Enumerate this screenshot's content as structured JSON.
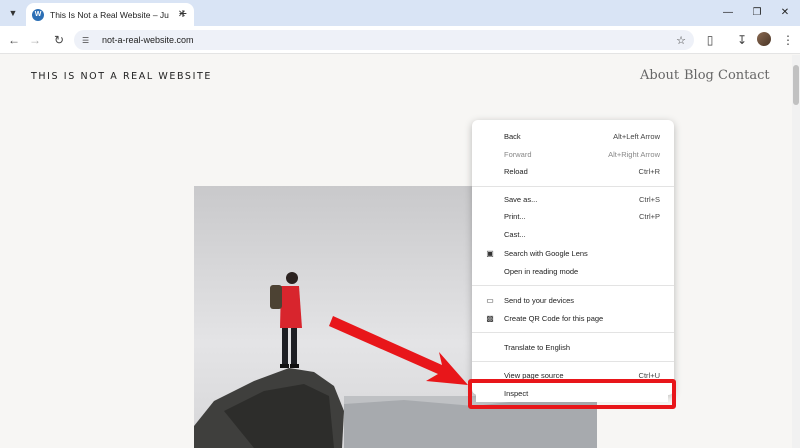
{
  "browser": {
    "tab_title": "This Is Not a Real Website – Ju",
    "favicon_letter": "W",
    "url": "not-a-real-website.com"
  },
  "site": {
    "title": "THIS IS NOT A REAL WEBSITE",
    "nav": [
      "About",
      "Blog",
      "Contact"
    ]
  },
  "context_menu": {
    "items": [
      {
        "label": "Back",
        "shortcut": "Alt+Left Arrow",
        "disabled": false
      },
      {
        "label": "Forward",
        "shortcut": "Alt+Right Arrow",
        "disabled": true
      },
      {
        "label": "Reload",
        "shortcut": "Ctrl+R",
        "disabled": false
      },
      {
        "label": "Save as...",
        "shortcut": "Ctrl+S",
        "disabled": false
      },
      {
        "label": "Print...",
        "shortcut": "Ctrl+P",
        "disabled": false
      },
      {
        "label": "Cast...",
        "shortcut": "",
        "disabled": false
      },
      {
        "label": "Search with Google Lens",
        "shortcut": "",
        "icon": "lens-icon",
        "disabled": false
      },
      {
        "label": "Open in reading mode",
        "shortcut": "",
        "disabled": false
      },
      {
        "label": "Send to your devices",
        "shortcut": "",
        "icon": "devices-icon",
        "disabled": false
      },
      {
        "label": "Create QR Code for this page",
        "shortcut": "",
        "icon": "qr-code-icon",
        "disabled": false
      },
      {
        "label": "Translate to English",
        "shortcut": "",
        "disabled": false
      },
      {
        "label": "View page source",
        "shortcut": "Ctrl+U",
        "disabled": false
      },
      {
        "label": "Inspect",
        "shortcut": "",
        "disabled": false
      }
    ]
  },
  "colors": {
    "highlight": "#e8161a",
    "tabstrip": "#d9e4f5"
  }
}
